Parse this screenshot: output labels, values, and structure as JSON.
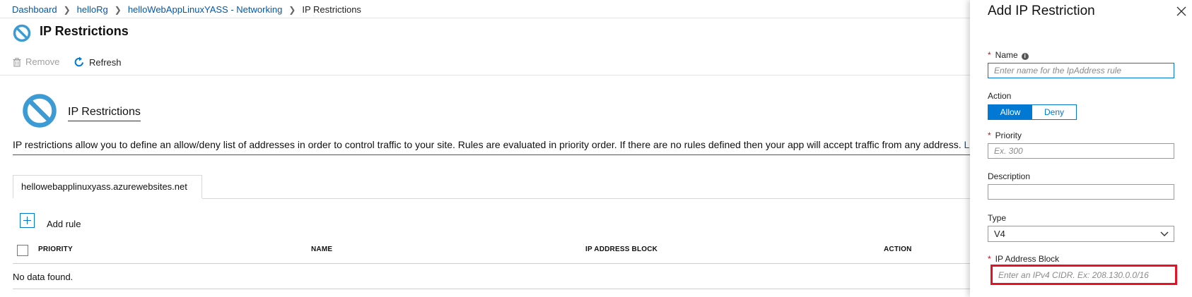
{
  "breadcrumb": {
    "items": [
      "Dashboard",
      "helloRg",
      "helloWebAppLinuxYASS - Networking"
    ],
    "current": "IP Restrictions"
  },
  "page": {
    "title": "IP Restrictions"
  },
  "toolbar": {
    "remove_label": "Remove",
    "refresh_label": "Refresh"
  },
  "section": {
    "title": "IP Restrictions",
    "description": "IP restrictions allow you to define an allow/deny list of addresses in order to control traffic to your site. Rules are evaluated in priority order. If there are no rules defined then your app will accept traffic from any address.",
    "link_fragment": "L"
  },
  "tabs": [
    {
      "label": "hellowebapplinuxyass.azurewebsites.net"
    }
  ],
  "add_rule_label": "Add rule",
  "table": {
    "columns": [
      "PRIORITY",
      "NAME",
      "IP ADDRESS BLOCK",
      "ACTION"
    ],
    "empty_text": "No data found."
  },
  "blade": {
    "title": "Add IP Restriction",
    "name": {
      "label": "Name",
      "placeholder": "Enter name for the IpAddress rule"
    },
    "action": {
      "label": "Action",
      "options": [
        "Allow",
        "Deny"
      ],
      "selected": "Allow"
    },
    "priority": {
      "label": "Priority",
      "placeholder": "Ex. 300"
    },
    "description": {
      "label": "Description",
      "placeholder": ""
    },
    "type": {
      "label": "Type",
      "value": "V4"
    },
    "ip_block": {
      "label": "IP Address Block",
      "placeholder": "Enter an IPv4 CIDR. Ex: 208.130.0.0/16"
    }
  },
  "colors": {
    "accent": "#0078d4",
    "link": "#0058ad",
    "required": "#c50f1f",
    "highlight": "#e81123"
  }
}
